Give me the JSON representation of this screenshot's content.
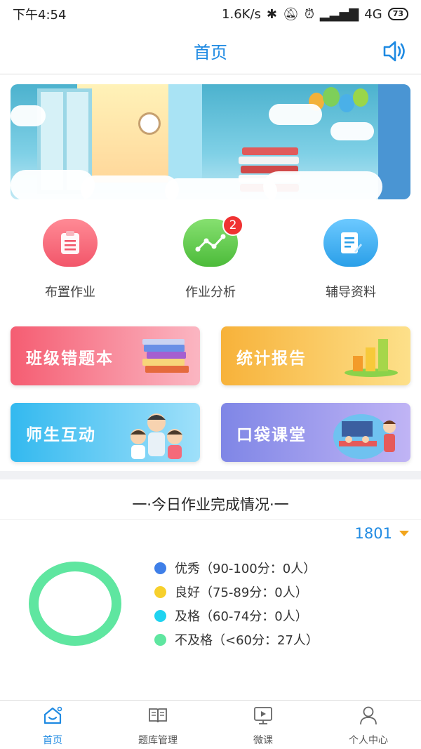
{
  "status_bar": {
    "time": "下午4:54",
    "net_speed": "1.6K/s",
    "network": "4G",
    "battery": "73"
  },
  "header": {
    "title": "首页"
  },
  "quick_actions": [
    {
      "label": "布置作业",
      "icon": "clipboard-icon",
      "color": "#f05a6e"
    },
    {
      "label": "作业分析",
      "icon": "line-chart-icon",
      "color": "#5fcc4a",
      "badge": "2"
    },
    {
      "label": "辅导资料",
      "icon": "document-edit-icon",
      "color": "#2fa8ee"
    }
  ],
  "feature_cards": [
    {
      "label": "班级错题本",
      "icon": "books-icon"
    },
    {
      "label": "统计报告",
      "icon": "bar-chart-icon"
    },
    {
      "label": "师生互动",
      "icon": "teacher-students-icon"
    },
    {
      "label": "口袋课堂",
      "icon": "classroom-icon"
    }
  ],
  "completion": {
    "title": "一·今日作业完成情况·一",
    "class_selector": "1801",
    "legend": [
      {
        "label": "优秀（90-100分：0人）",
        "color": "#3f7fe8",
        "count": 0
      },
      {
        "label": "良好（75-89分：0人）",
        "color": "#f7d02c",
        "count": 0
      },
      {
        "label": "及格（60-74分：0人）",
        "color": "#1fd3f0",
        "count": 0
      },
      {
        "label": "不及格（<60分：27人）",
        "color": "#5fe6a0",
        "count": 27
      }
    ]
  },
  "chart_data": {
    "type": "pie",
    "categories": [
      "优秀",
      "良好",
      "及格",
      "不及格"
    ],
    "values": [
      0,
      0,
      0,
      27
    ],
    "colors": [
      "#3f7fe8",
      "#f7d02c",
      "#1fd3f0",
      "#5fe6a0"
    ]
  },
  "tab_bar": [
    {
      "label": "首页",
      "icon": "home-icon",
      "active": true
    },
    {
      "label": "题库管理",
      "icon": "open-book-icon",
      "active": false
    },
    {
      "label": "微课",
      "icon": "video-play-icon",
      "active": false
    },
    {
      "label": "个人中心",
      "icon": "person-icon",
      "active": false
    }
  ],
  "colors": {
    "accent": "#1f8ae2",
    "selector_arrow": "#f2a51c"
  }
}
